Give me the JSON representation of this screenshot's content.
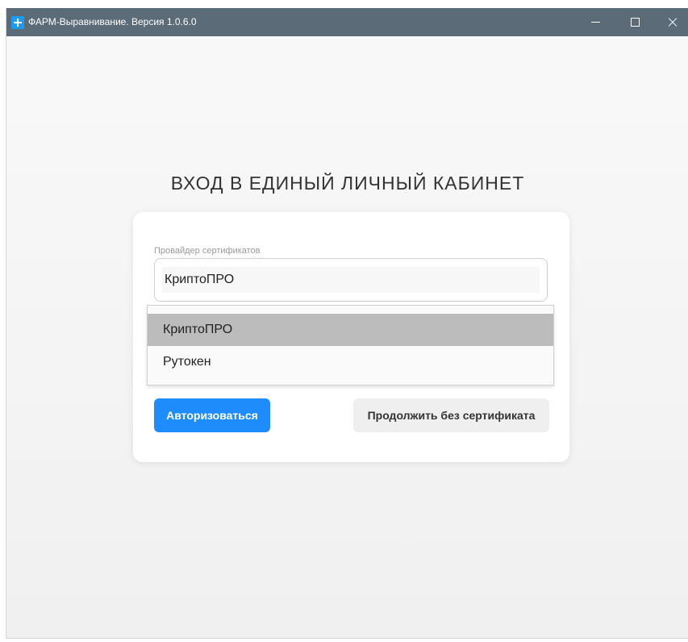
{
  "window": {
    "title": "ФАРМ-Выравнивание. Версия 1.0.6.0",
    "icon": "medical-cross-icon",
    "controls": [
      "minimize-icon",
      "maximize-icon",
      "close-icon"
    ]
  },
  "login": {
    "heading": "ВХОД В ЕДИНЫЙ ЛИЧНЫЙ КАБИНЕТ",
    "provider_label": "Провайдер сертификатов",
    "provider_value": "КриптоПРО",
    "options": [
      "КриптоПРО",
      "Рутокен"
    ],
    "highlighted_option": "КриптоПРО",
    "authorize_label": "Авторизоваться",
    "continue_label": "Продолжить без сертификата"
  },
  "colors": {
    "titlebar": "#5b6b78",
    "primary": "#1f8cfb",
    "option_highlight": "#bcbcbc",
    "secondary_button": "#efefef"
  }
}
